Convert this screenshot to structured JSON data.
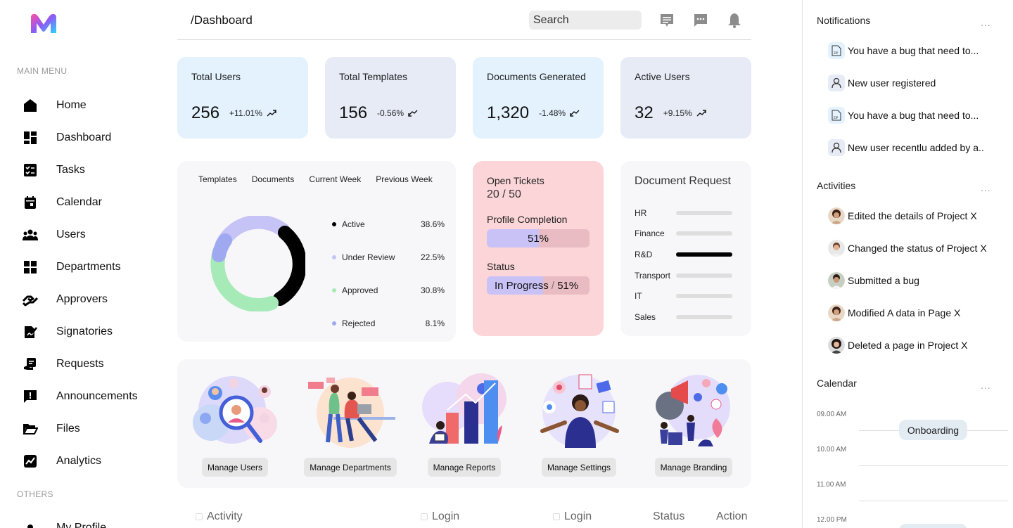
{
  "sidebar": {
    "main_menu_heading": "MAIN MENU",
    "others_heading": "OTHERS",
    "items": [
      {
        "label": "Home",
        "icon": "home-icon"
      },
      {
        "label": "Dashboard",
        "icon": "dashboard-icon"
      },
      {
        "label": "Tasks",
        "icon": "tasks-icon"
      },
      {
        "label": "Calendar",
        "icon": "calendar-icon"
      },
      {
        "label": "Users",
        "icon": "users-icon"
      },
      {
        "label": "Departments",
        "icon": "departments-icon"
      },
      {
        "label": "Approvers",
        "icon": "approvers-icon"
      },
      {
        "label": "Signatories",
        "icon": "signatories-icon"
      },
      {
        "label": "Requests",
        "icon": "requests-icon"
      },
      {
        "label": "Announcements",
        "icon": "announcements-icon"
      },
      {
        "label": "Files",
        "icon": "files-icon"
      },
      {
        "label": "Analytics",
        "icon": "analytics-icon"
      }
    ],
    "others_items": [
      {
        "label": "My Profile",
        "icon": "profile-icon"
      }
    ]
  },
  "header": {
    "title": "/Dashboard",
    "search_placeholder": "Search"
  },
  "stats": [
    {
      "title": "Total Users",
      "value": "256",
      "delta": "+11.01%",
      "trend": "up",
      "bg": "#e3f2fd"
    },
    {
      "title": "Total Templates",
      "value": "156",
      "delta": "-0.56%",
      "trend": "down",
      "bg": "#e6ebf6"
    },
    {
      "title": "Documents Generated",
      "value": "1,320",
      "delta": "-1.48%",
      "trend": "down",
      "bg": "#e3f2fd"
    },
    {
      "title": "Active Users",
      "value": "32",
      "delta": "+9.15%",
      "trend": "up",
      "bg": "#e6ebf6"
    }
  ],
  "donut": {
    "tabs": [
      "Templates",
      "Documents",
      "Current Week",
      "Previous Week"
    ],
    "legend": [
      {
        "label": "Active",
        "pct": "38.6%",
        "color": "#000000"
      },
      {
        "label": "Under Review",
        "pct": "22.5%",
        "color": "#c6c3f6"
      },
      {
        "label": "Approved",
        "pct": "30.8%",
        "color": "#a6eab8"
      },
      {
        "label": "Rejected",
        "pct": "8.1%",
        "color": "#9ea9f0"
      }
    ]
  },
  "tickets": {
    "open_label": "Open Tickets",
    "open_value": "20 / 50",
    "profile_label": "Profile Completion",
    "profile_value": "51%",
    "profile_fraction": 0.51,
    "status_label": "Status",
    "status_value": "In Progress",
    "status_sep": "/",
    "status_pct": "51%",
    "status_fraction": 0.55
  },
  "doc_request": {
    "title": "Document Request",
    "rows": [
      {
        "label": "HR",
        "value": 0
      },
      {
        "label": "Finance",
        "value": 0
      },
      {
        "label": "R&D",
        "value": 1
      },
      {
        "label": "Transport",
        "value": 0
      },
      {
        "label": "IT",
        "value": 0
      },
      {
        "label": "Sales",
        "value": 0
      }
    ]
  },
  "manage": [
    {
      "label": "Manage Users"
    },
    {
      "label": "Manage Departments"
    },
    {
      "label": "Manage Reports"
    },
    {
      "label": "Manage Settings"
    },
    {
      "label": "Manage Branding"
    }
  ],
  "table": {
    "headers": [
      "Activity",
      "Login",
      "Login",
      "Status",
      "Action"
    ]
  },
  "notifications": {
    "title": "Notifications",
    "more": "...",
    "items": [
      {
        "text": "You have a bug that need to...",
        "icon": "bug-file-icon"
      },
      {
        "text": "New user registered",
        "icon": "user-icon"
      },
      {
        "text": "You have a bug that need to...",
        "icon": "bug-file-icon"
      },
      {
        "text": "New user recentlu added by a..",
        "icon": "user-icon"
      }
    ]
  },
  "activities": {
    "title": "Activities",
    "more": "...",
    "items": [
      {
        "text": "Edited the details of Project X"
      },
      {
        "text": "Changed the status of Project X"
      },
      {
        "text": "Submitted a bug"
      },
      {
        "text": "Modified A data in Page X"
      },
      {
        "text": "Deleted a page in Project X"
      }
    ]
  },
  "calendar": {
    "title": "Calendar",
    "more": "...",
    "times": [
      "09.00 AM",
      "10.00 AM",
      "11.00 AM",
      "12.00 PM"
    ],
    "event": "Onboarding"
  }
}
